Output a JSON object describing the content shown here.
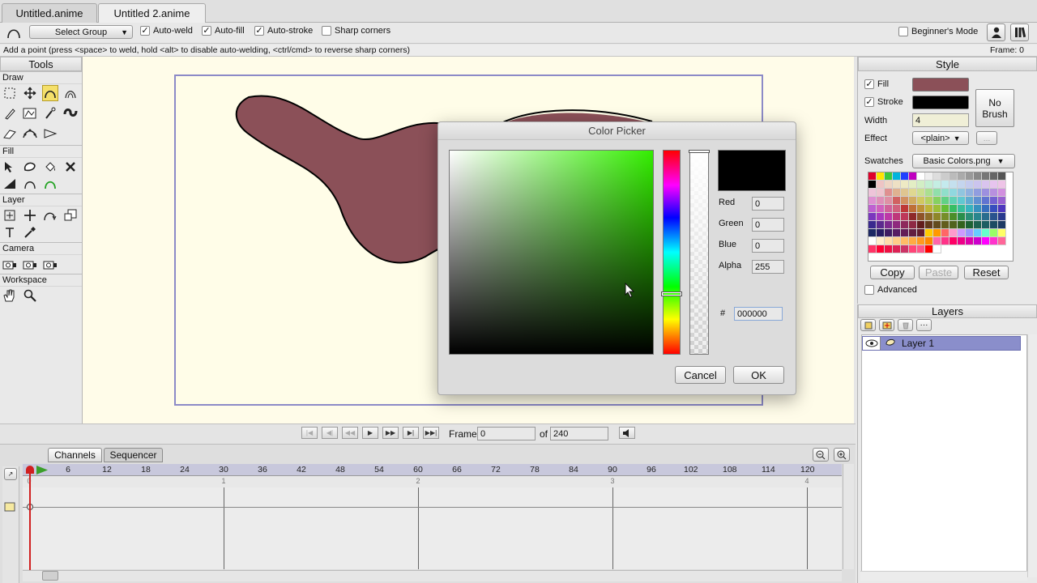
{
  "tabs": [
    {
      "label": "Untitled.anime"
    },
    {
      "label": "Untitled 2.anime"
    }
  ],
  "toolbar": {
    "select_group": "Select Group",
    "auto_weld": "Auto-weld",
    "auto_fill": "Auto-fill",
    "auto_stroke": "Auto-stroke",
    "sharp_corners": "Sharp corners",
    "beginner_mode": "Beginner's Mode"
  },
  "status": {
    "hint": "Add a point (press <space> to weld, hold <alt> to disable auto-welding, <ctrl/cmd> to reverse sharp corners)",
    "frame": "Frame: 0"
  },
  "tools": {
    "title": "Tools",
    "sections": {
      "draw": "Draw",
      "fill": "Fill",
      "layer": "Layer",
      "camera": "Camera",
      "workspace": "Workspace"
    }
  },
  "color_picker": {
    "title": "Color Picker",
    "red_label": "Red",
    "red": "0",
    "green_label": "Green",
    "green": "0",
    "blue_label": "Blue",
    "blue": "0",
    "alpha_label": "Alpha",
    "alpha": "255",
    "hash_label": "#",
    "hex": "000000",
    "cancel": "Cancel",
    "ok": "OK"
  },
  "style": {
    "title": "Style",
    "fill_label": "Fill",
    "stroke_label": "Stroke",
    "width_label": "Width",
    "width": "4",
    "effect_label": "Effect",
    "effect": "<plain>",
    "no_brush": "No\nBrush",
    "swatches_label": "Swatches",
    "swatches": "Basic Colors.png",
    "copy": "Copy",
    "paste": "Paste",
    "reset": "Reset",
    "advanced": "Advanced",
    "fill_color": "#8b5058",
    "stroke_color": "#000000"
  },
  "layers": {
    "title": "Layers",
    "items": [
      {
        "name": "Layer 1"
      }
    ]
  },
  "transport": {
    "frame_label": "Frame",
    "frame": "0",
    "of_label": "of",
    "total": "240"
  },
  "timeline": {
    "channels": "Channels",
    "sequencer": "Sequencer",
    "ticks": [
      "6",
      "12",
      "18",
      "24",
      "30",
      "36",
      "42",
      "48",
      "54",
      "60",
      "66",
      "72",
      "78",
      "84",
      "90",
      "96",
      "102",
      "108",
      "114",
      "120"
    ],
    "seconds": [
      "0",
      "1",
      "2",
      "3",
      "4"
    ]
  }
}
